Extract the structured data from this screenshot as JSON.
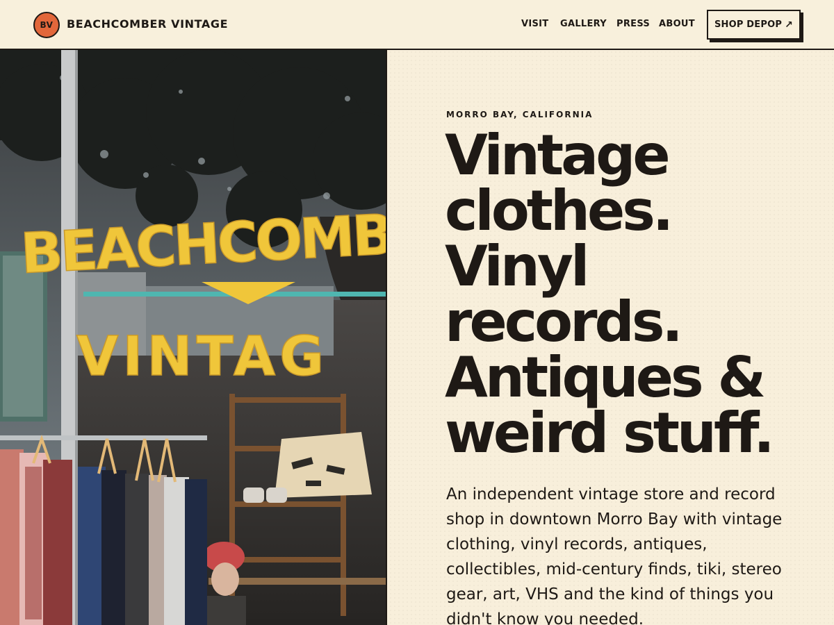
{
  "header": {
    "logo_initials": "BV",
    "brand_name": "BEACHCOMBER VINTAGE",
    "nav": [
      "VISIT",
      "GALLERY",
      "PRESS",
      "ABOUT"
    ],
    "cta_label": "SHOP DEPOP",
    "cta_icon": "arrow-up-right-icon"
  },
  "hero": {
    "eyebrow": "MORRO BAY, CALIFORNIA",
    "headline_lines": [
      "Vintage",
      "clothes.",
      "Vinyl",
      "records.",
      "Antiques &",
      "weird stuff."
    ],
    "description": "An independent vintage store and record shop in downtown Morro Bay with vintage clothing, vinyl records, antiques, collectibles, mid-century finds, tiki, stereo gear, art, VHS and the kind of things you didn't know you needed."
  },
  "storefront_photo": {
    "window_sign_lines": [
      "BEACHCOMB",
      "VINTAG"
    ]
  },
  "colors": {
    "background": "#f8efdb",
    "ink": "#1e1915",
    "accent": "#e2673b",
    "sign_yellow": "#f0c63a"
  }
}
